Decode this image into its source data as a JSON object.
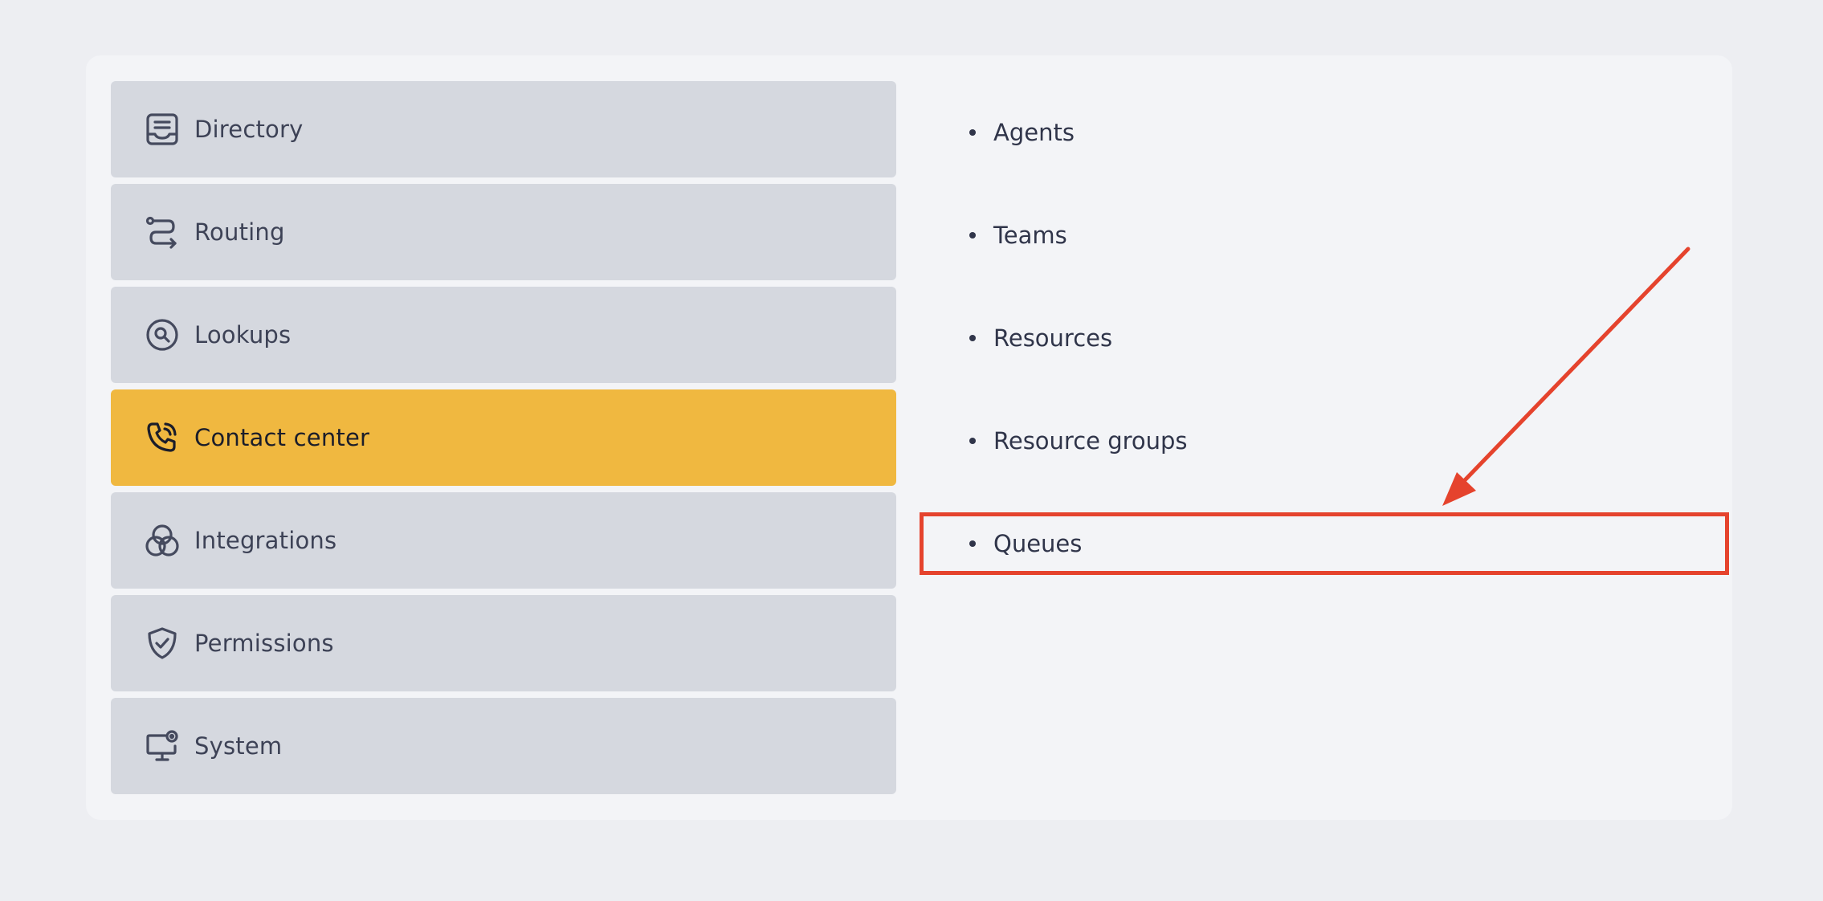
{
  "menu": {
    "items": [
      {
        "label": "Directory",
        "icon": "directory-icon",
        "active": false
      },
      {
        "label": "Routing",
        "icon": "routing-icon",
        "active": false
      },
      {
        "label": "Lookups",
        "icon": "lookups-icon",
        "active": false
      },
      {
        "label": "Contact center",
        "icon": "contact-center-icon",
        "active": true
      },
      {
        "label": "Integrations",
        "icon": "integrations-icon",
        "active": false
      },
      {
        "label": "Permissions",
        "icon": "permissions-icon",
        "active": false
      },
      {
        "label": "System",
        "icon": "system-icon",
        "active": false
      }
    ]
  },
  "submenu": {
    "items": [
      {
        "label": "Agents"
      },
      {
        "label": "Teams"
      },
      {
        "label": "Resources"
      },
      {
        "label": "Resource groups"
      },
      {
        "label": "Queues"
      }
    ]
  },
  "colors": {
    "active_item": "#f0b840",
    "inactive_item": "#d5d8df",
    "annotation": "#e5432d"
  }
}
